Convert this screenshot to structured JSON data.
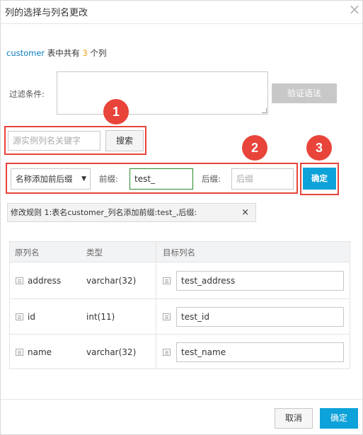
{
  "dialog": {
    "title": "列的选择与列名更改",
    "close_icon": "close-icon"
  },
  "info": {
    "table_name": "customer",
    "text_mid": " 表中共有 ",
    "count": "3",
    "text_end": " 个列"
  },
  "filter": {
    "label": "过滤条件:",
    "value": "",
    "verify_button": "验证语法"
  },
  "search": {
    "placeholder": "源实例列名关键字",
    "button": "搜索"
  },
  "rename": {
    "mode_selected": "名称添加前后缀",
    "prefix_label": "前缀:",
    "prefix_value": "test_",
    "suffix_label": "后缀:",
    "suffix_placeholder": "后缀",
    "confirm_button": "确定"
  },
  "badges": [
    "1",
    "2",
    "3"
  ],
  "rule": {
    "text": "修改规则 1:表名customer_列名添加前缀:test_,后缀:",
    "remove_icon": "×"
  },
  "table": {
    "headers": [
      "原列名",
      "类型",
      "目标列名"
    ],
    "rows": [
      {
        "name": "address",
        "type": "varchar(32)",
        "target": "test_address"
      },
      {
        "name": "id",
        "type": "int(11)",
        "target": "test_id"
      },
      {
        "name": "name",
        "type": "varchar(32)",
        "target": "test_name"
      }
    ]
  },
  "footer": {
    "cancel": "取消",
    "ok": "确定"
  },
  "colors": {
    "accent_blue": "#0da2d9",
    "annotation_red": "#e8443a",
    "link_blue": "#0a7ec1",
    "count_orange": "#f0a31a"
  }
}
